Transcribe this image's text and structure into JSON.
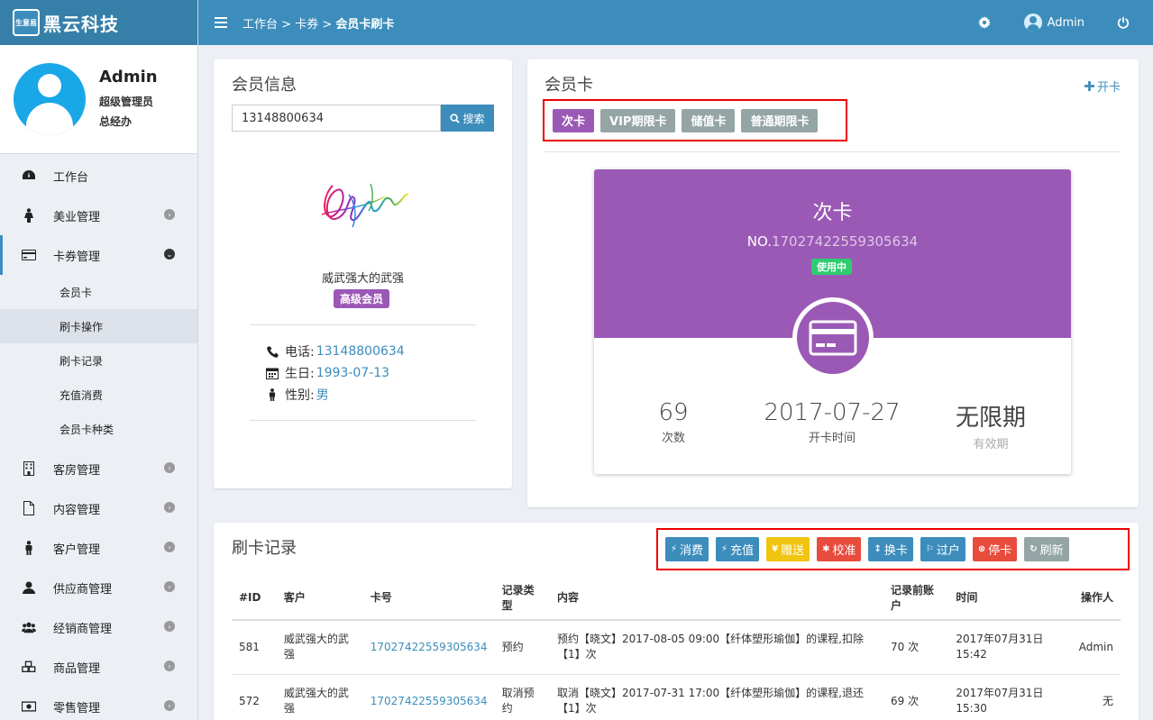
{
  "brand": {
    "logo_text": "生意易",
    "name": "黑云科技"
  },
  "topbar": {
    "breadcrumb": [
      "工作台",
      "卡券",
      "会员卡刷卡"
    ],
    "separator": " > ",
    "user": "Admin"
  },
  "profile": {
    "name": "Admin",
    "role": "超级管理员",
    "title": "总经办"
  },
  "sidebar": {
    "items": [
      {
        "label": "工作台",
        "icon": "dashboard-icon",
        "has_children": false
      },
      {
        "label": "美业管理",
        "icon": "female-icon",
        "has_children": true
      },
      {
        "label": "卡券管理",
        "icon": "credit-card-icon",
        "has_children": true,
        "expanded": true
      },
      {
        "label": "客房管理",
        "icon": "building-icon",
        "has_children": true
      },
      {
        "label": "内容管理",
        "icon": "file-icon",
        "has_children": true
      },
      {
        "label": "客户管理",
        "icon": "male-icon",
        "has_children": true
      },
      {
        "label": "供应商管理",
        "icon": "user-icon",
        "has_children": true
      },
      {
        "label": "经销商管理",
        "icon": "users-icon",
        "has_children": true
      },
      {
        "label": "商品管理",
        "icon": "cubes-icon",
        "has_children": true
      },
      {
        "label": "零售管理",
        "icon": "money-icon",
        "has_children": true
      }
    ],
    "submenu": [
      "会员卡",
      "刷卡操作",
      "刷卡记录",
      "充值消费",
      "会员卡种类"
    ],
    "submenu_current": "刷卡操作"
  },
  "member": {
    "title": "会员信息",
    "search_value": "13148800634",
    "search_button": "搜索",
    "name": "威武强大的武强",
    "level": "高级会员",
    "phone_label": "电话:",
    "phone": "13148800634",
    "birthday_label": "生日:",
    "birthday": "1993-07-13",
    "gender_label": "性别:",
    "gender": "男"
  },
  "card": {
    "title": "会员卡",
    "open_card": "开卡",
    "tabs": [
      "次卡",
      "VIP期限卡",
      "储值卡",
      "普通期限卡"
    ],
    "active_tab": "次卡",
    "card_name": "次卡",
    "no_prefix": "NO.",
    "card_no": "17027422559305634",
    "status": "使用中",
    "stats": [
      {
        "value": "69",
        "label": "次数",
        "muted": false
      },
      {
        "value": "2017-07-27",
        "label": "开卡时间",
        "muted": false
      },
      {
        "value": "无限期",
        "label": "有效期",
        "muted": true
      }
    ]
  },
  "records": {
    "title": "刷卡记录",
    "actions": [
      {
        "label": "消费",
        "icon": "⚡",
        "color": "#3c8dbc"
      },
      {
        "label": "充值",
        "icon": "⚡",
        "color": "#3c8dbc"
      },
      {
        "label": "赠送",
        "icon": "¥",
        "color": "#f1c40f"
      },
      {
        "label": "校准",
        "icon": "✱",
        "color": "#e74c3c"
      },
      {
        "label": "换卡",
        "icon": "↕",
        "color": "#3c8dbc"
      },
      {
        "label": "过户",
        "icon": "⚐",
        "color": "#3c8dbc"
      },
      {
        "label": "停卡",
        "icon": "⊗",
        "color": "#e74c3c"
      },
      {
        "label": "刷新",
        "icon": "↻",
        "color": "#95a5a6"
      }
    ],
    "columns": [
      "#ID",
      "客户",
      "卡号",
      "记录类型",
      "内容",
      "记录前账户",
      "时间",
      "操作人"
    ],
    "rows": [
      [
        "581",
        "威武强大的武强",
        "17027422559305634",
        "预约",
        "预约【晓文】2017-08-05 09:00【纤体塑形瑜伽】的课程,扣除【1】次",
        "70 次",
        "2017年07月31日 15:42",
        "Admin"
      ],
      [
        "572",
        "威武强大的武强",
        "17027422559305634",
        "取消预约",
        "取消【晓文】2017-07-31 17:00【纤体塑形瑜伽】的课程,退还【1】次",
        "69 次",
        "2017年07月31日 15:30",
        "无"
      ]
    ]
  },
  "colors": {
    "primary": "#3c8dbc",
    "purple": "#9b59b6",
    "gray": "#95a5a6",
    "green": "#2ecc71",
    "red": "#e74c3c",
    "yellow": "#f1c40f",
    "highlight_border": "#ee0000"
  }
}
